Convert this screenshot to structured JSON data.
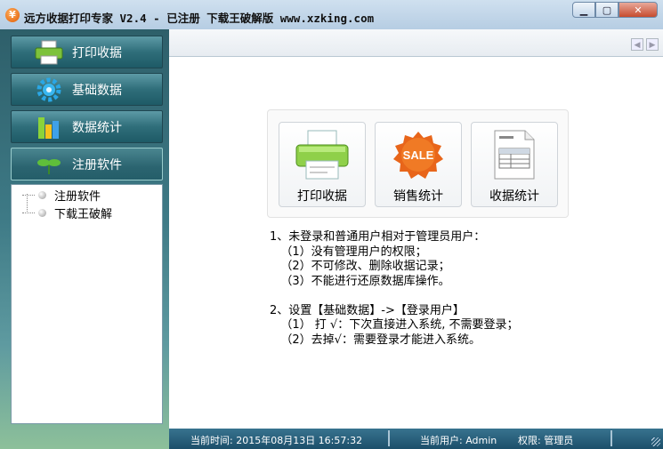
{
  "window": {
    "title": "远方收据打印专家 V2.4 - 已注册   下载王破解版 www.xzking.com",
    "app_icon_glyph": "¥",
    "controls": {
      "minimize": "▁",
      "maximize": "▢",
      "close": "✕"
    }
  },
  "sidebar": {
    "items": [
      {
        "label": "打印收据",
        "icon": "printer-icon"
      },
      {
        "label": "基础数据",
        "icon": "gear-icon"
      },
      {
        "label": "数据统计",
        "icon": "bar-chart-icon"
      },
      {
        "label": "注册软件",
        "icon": "sprout-icon"
      }
    ],
    "tree": [
      "注册软件",
      "下载王破解"
    ]
  },
  "main": {
    "tiles": [
      {
        "label": "打印收据",
        "icon": "printer-icon"
      },
      {
        "label": "销售统计",
        "icon": "sale-badge-icon",
        "badge": "SALE"
      },
      {
        "label": "收据统计",
        "icon": "document-icon"
      }
    ],
    "notes": [
      "1、未登录和普通用户相对于管理员用户：",
      "   （1）没有管理用户的权限；",
      "   （2）不可修改、删除收据记录；",
      "   （3）不能进行还原数据库操作。",
      "",
      "2、设置【基础数据】->【登录用户】",
      "   （1） 打 √：下次直接进入系统, 不需要登录；",
      "   （2）去掉√：需要登录才能进入系统。"
    ]
  },
  "status": {
    "time": "当前时间: 2015年08月13日 16:57:32",
    "user": "当前用户: Admin",
    "role": "权限: 管理员"
  },
  "colors": {
    "accent": "#2f6e7a",
    "status_bar": "#1c4f6a",
    "sale": "#e8651a"
  }
}
